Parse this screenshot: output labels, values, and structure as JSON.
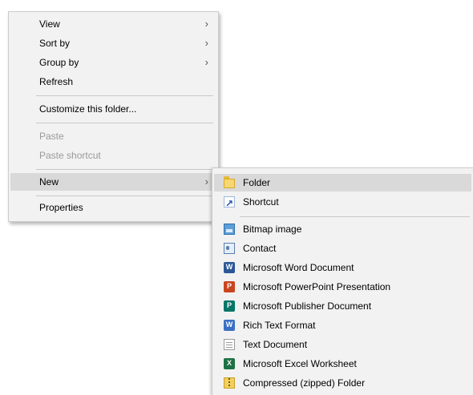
{
  "context_menu": {
    "items": [
      {
        "label": "View",
        "has_submenu": true
      },
      {
        "label": "Sort by",
        "has_submenu": true
      },
      {
        "label": "Group by",
        "has_submenu": true
      },
      {
        "label": "Refresh",
        "has_submenu": false
      },
      {
        "label": "Customize this folder...",
        "has_submenu": false
      },
      {
        "label": "Paste",
        "disabled": true
      },
      {
        "label": "Paste shortcut",
        "disabled": true
      },
      {
        "label": "New",
        "has_submenu": true,
        "highlighted": true
      },
      {
        "label": "Properties",
        "has_submenu": false
      }
    ],
    "submenu_arrow_glyph": "›"
  },
  "new_submenu": {
    "items": [
      {
        "label": "Folder",
        "icon": "folder-icon",
        "highlighted": true
      },
      {
        "label": "Shortcut",
        "icon": "shortcut-icon"
      },
      {
        "label": "Bitmap image",
        "icon": "bitmap-icon"
      },
      {
        "label": "Contact",
        "icon": "contact-icon"
      },
      {
        "label": "Microsoft Word Document",
        "icon": "word-icon",
        "icon_letter": "W"
      },
      {
        "label": "Microsoft PowerPoint Presentation",
        "icon": "powerpoint-icon",
        "icon_letter": "P"
      },
      {
        "label": "Microsoft Publisher Document",
        "icon": "publisher-icon",
        "icon_letter": "P"
      },
      {
        "label": "Rich Text Format",
        "icon": "rich-text-icon",
        "icon_letter": "W"
      },
      {
        "label": "Text Document",
        "icon": "text-document-icon"
      },
      {
        "label": "Microsoft Excel Worksheet",
        "icon": "excel-icon",
        "icon_letter": "X"
      },
      {
        "label": "Compressed (zipped) Folder",
        "icon": "zip-folder-icon"
      }
    ]
  },
  "colors": {
    "menu_background": "#f2f2f2",
    "highlight": "#d9d9d9",
    "disabled_text": "#9a9a9a",
    "separator": "#c8c8c8"
  }
}
